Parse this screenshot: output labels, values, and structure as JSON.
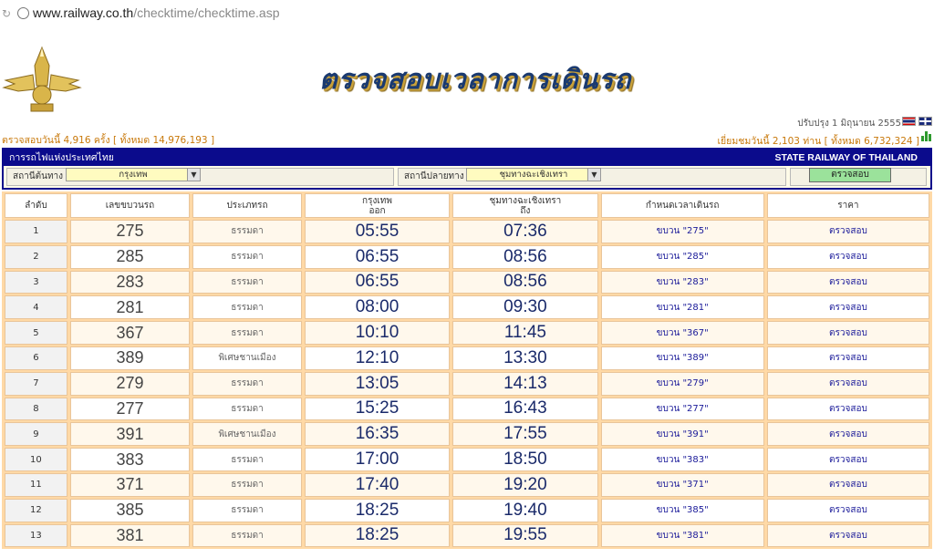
{
  "browser": {
    "url_host": "www.railway.co.th",
    "url_path": "/checktime/checktime.asp"
  },
  "header": {
    "title": "ตรวจสอบเวลาการเดินรถ",
    "updated": "ปรับปรุง 1 มิถุนายน 2555",
    "stats_left": "ตรวจสอบวันนี้ 4,916 ครั้ง",
    "stats_left_total": "[ ทั้งหมด 14,976,193 ]",
    "stats_right": "เยี่ยมชมวันนี้ 2,103 ท่าน",
    "stats_right_total": "[ ทั้งหมด 6,732,324 ]"
  },
  "panel": {
    "org_th": "การรถไฟแห่งประเทศไทย",
    "org_en": "STATE RAILWAY OF THAILAND",
    "origin_label": "สถานีต้นทาง",
    "origin_value": "กรุงเทพ",
    "dest_label": "สถานีปลายทาง",
    "dest_value": "ชุมทางฉะเชิงเทรา",
    "check_button": "ตรวจสอบ"
  },
  "table": {
    "headers": {
      "idx": "ลำดับ",
      "train": "เลขขบวนรถ",
      "type": "ประเภทรถ",
      "depart_station": "กรุงเทพ",
      "depart_word": "ออก",
      "arrive_station": "ชุมทางฉะเชิงเทรา",
      "arrive_word": "ถึง",
      "schedule": "กำหนดเวลาเดินรถ",
      "price": "ราคา"
    },
    "rows": [
      {
        "idx": "1",
        "train": "275",
        "type": "ธรรมดา",
        "depart": "05:55",
        "arrive": "07:36",
        "sched": "ขบวน \"275\"",
        "price": "ตรวจสอบ"
      },
      {
        "idx": "2",
        "train": "285",
        "type": "ธรรมดา",
        "depart": "06:55",
        "arrive": "08:56",
        "sched": "ขบวน \"285\"",
        "price": "ตรวจสอบ"
      },
      {
        "idx": "3",
        "train": "283",
        "type": "ธรรมดา",
        "depart": "06:55",
        "arrive": "08:56",
        "sched": "ขบวน \"283\"",
        "price": "ตรวจสอบ"
      },
      {
        "idx": "4",
        "train": "281",
        "type": "ธรรมดา",
        "depart": "08:00",
        "arrive": "09:30",
        "sched": "ขบวน \"281\"",
        "price": "ตรวจสอบ"
      },
      {
        "idx": "5",
        "train": "367",
        "type": "ธรรมดา",
        "depart": "10:10",
        "arrive": "11:45",
        "sched": "ขบวน \"367\"",
        "price": "ตรวจสอบ"
      },
      {
        "idx": "6",
        "train": "389",
        "type": "พิเศษชานเมือง",
        "depart": "12:10",
        "arrive": "13:30",
        "sched": "ขบวน \"389\"",
        "price": "ตรวจสอบ"
      },
      {
        "idx": "7",
        "train": "279",
        "type": "ธรรมดา",
        "depart": "13:05",
        "arrive": "14:13",
        "sched": "ขบวน \"279\"",
        "price": "ตรวจสอบ"
      },
      {
        "idx": "8",
        "train": "277",
        "type": "ธรรมดา",
        "depart": "15:25",
        "arrive": "16:43",
        "sched": "ขบวน \"277\"",
        "price": "ตรวจสอบ"
      },
      {
        "idx": "9",
        "train": "391",
        "type": "พิเศษชานเมือง",
        "depart": "16:35",
        "arrive": "17:55",
        "sched": "ขบวน \"391\"",
        "price": "ตรวจสอบ"
      },
      {
        "idx": "10",
        "train": "383",
        "type": "ธรรมดา",
        "depart": "17:00",
        "arrive": "18:50",
        "sched": "ขบวน \"383\"",
        "price": "ตรวจสอบ"
      },
      {
        "idx": "11",
        "train": "371",
        "type": "ธรรมดา",
        "depart": "17:40",
        "arrive": "19:20",
        "sched": "ขบวน \"371\"",
        "price": "ตรวจสอบ"
      },
      {
        "idx": "12",
        "train": "385",
        "type": "ธรรมดา",
        "depart": "18:25",
        "arrive": "19:40",
        "sched": "ขบวน \"385\"",
        "price": "ตรวจสอบ"
      },
      {
        "idx": "13",
        "train": "381",
        "type": "ธรรมดา",
        "depart": "18:25",
        "arrive": "19:55",
        "sched": "ขบวน \"381\"",
        "price": "ตรวจสอบ"
      }
    ]
  }
}
